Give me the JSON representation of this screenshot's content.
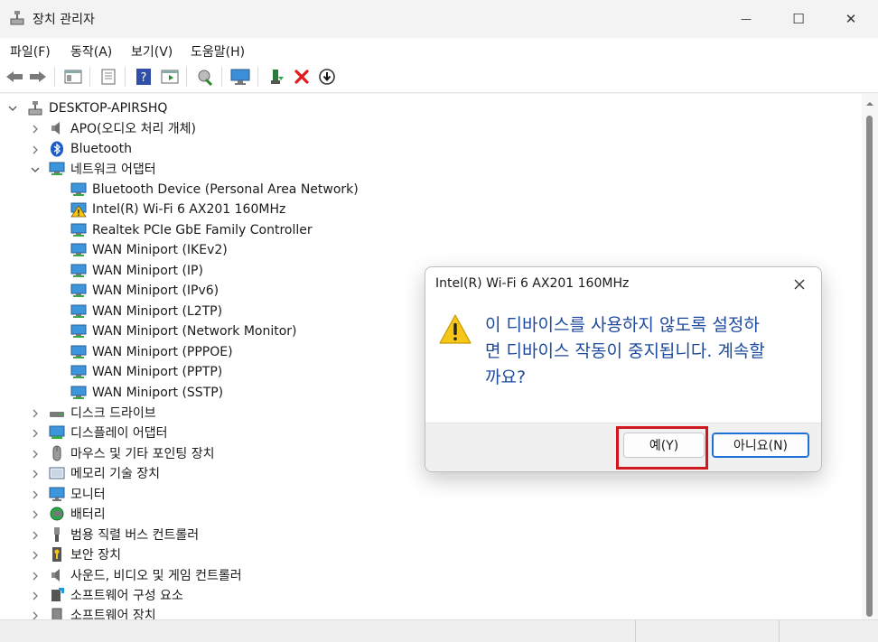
{
  "window": {
    "title": "장치 관리자",
    "minimize_glyph": "—",
    "maximize_glyph": "☐",
    "close_glyph": "✕"
  },
  "menu": [
    {
      "label": "파일(F)"
    },
    {
      "label": "동작(A)"
    },
    {
      "label": "보기(V)"
    },
    {
      "label": "도움말(H)"
    }
  ],
  "toolbar": {
    "icons": [
      "back-arrow-icon",
      "forward-arrow-icon",
      "show-hide-console-tree-icon",
      "properties-icon",
      "help-icon",
      "action-pane-icon",
      "update-driver-icon",
      "scan-hardware-icon",
      "enable-device-icon",
      "uninstall-device-icon",
      "disable-device-icon"
    ]
  },
  "tree": {
    "root": "DESKTOP-APIRSHQ",
    "categories_top": [
      {
        "label": "APO(오디오 처리 개체)"
      },
      {
        "label": "Bluetooth"
      },
      {
        "label": "네트워크 어댑터"
      }
    ],
    "network_children": [
      {
        "label": "Bluetooth Device (Personal Area Network)"
      },
      {
        "label": "Intel(R) Wi-Fi 6 AX201 160MHz"
      },
      {
        "label": "Realtek PCIe GbE Family Controller"
      },
      {
        "label": "WAN Miniport (IKEv2)"
      },
      {
        "label": "WAN Miniport (IP)"
      },
      {
        "label": "WAN Miniport (IPv6)"
      },
      {
        "label": "WAN Miniport (L2TP)"
      },
      {
        "label": "WAN Miniport (Network Monitor)"
      },
      {
        "label": "WAN Miniport (PPPOE)"
      },
      {
        "label": "WAN Miniport (PPTP)"
      },
      {
        "label": "WAN Miniport (SSTP)"
      }
    ],
    "categories_bottom": [
      {
        "label": "디스크 드라이브"
      },
      {
        "label": "디스플레이 어댑터"
      },
      {
        "label": "마우스 및 기타 포인팅 장치"
      },
      {
        "label": "메모리 기술 장치"
      },
      {
        "label": "모니터"
      },
      {
        "label": "배터리"
      },
      {
        "label": "범용 직렬 버스 컨트롤러"
      },
      {
        "label": "보안 장치"
      },
      {
        "label": "사운드, 비디오 및 게임 컨트롤러"
      },
      {
        "label": "소프트웨어 구성 요소"
      },
      {
        "label": "소프트웨어 장치"
      }
    ]
  },
  "dialog": {
    "title": "Intel(R) Wi-Fi 6 AX201 160MHz",
    "message_line1": "이 디바이스를 사용하지 않도록 설정하",
    "message_line2": "면 디바이스 작동이 중지됩니다. 계속할",
    "message_line3": "까요?",
    "yes_label": "예(Y)",
    "no_label": "아니요(N)"
  },
  "colors": {
    "message_text": "#1e4a9e",
    "highlight_border": "#d0161f",
    "default_button_border": "#1f6fd6"
  }
}
